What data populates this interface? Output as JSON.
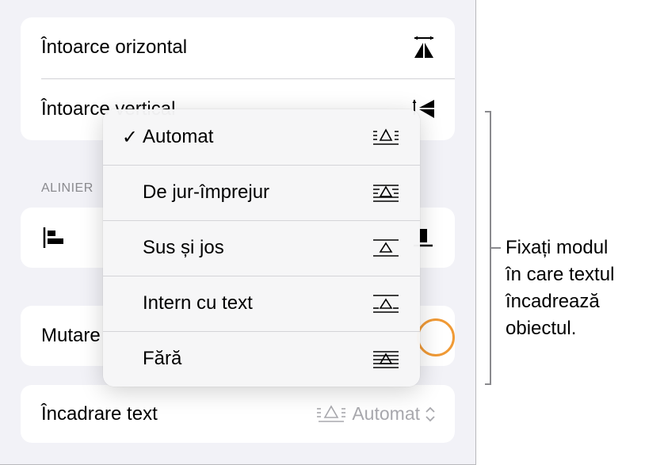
{
  "panel": {
    "flip_group": {
      "flip_horizontal_label": "Întoarce orizontal",
      "flip_vertical_label": "Întoarce vertical"
    },
    "align_section_header": "ALINIER",
    "move_row_label": "Mutare",
    "text_wrap_row": {
      "label": "Încadrare text",
      "value": "Automat",
      "icon": "wrap-automatic-icon"
    }
  },
  "wrap_menu": {
    "items": [
      {
        "label": "Automat",
        "checked": true,
        "icon": "wrap-automatic-icon"
      },
      {
        "label": "De jur-împrejur",
        "checked": false,
        "icon": "wrap-around-icon"
      },
      {
        "label": "Sus și jos",
        "checked": false,
        "icon": "wrap-above-below-icon"
      },
      {
        "label": "Intern cu text",
        "checked": false,
        "icon": "wrap-inline-icon"
      },
      {
        "label": "Fără",
        "checked": false,
        "icon": "wrap-none-icon"
      }
    ],
    "check_glyph": "✓"
  },
  "callout": {
    "lines": [
      "Fixați modul",
      "în care textul",
      "încadrează",
      "obiectul."
    ]
  },
  "colors": {
    "panel_bg": "#f2f2f7",
    "accent_orange": "#f09a36",
    "secondary_text": "#8a8a8e"
  }
}
